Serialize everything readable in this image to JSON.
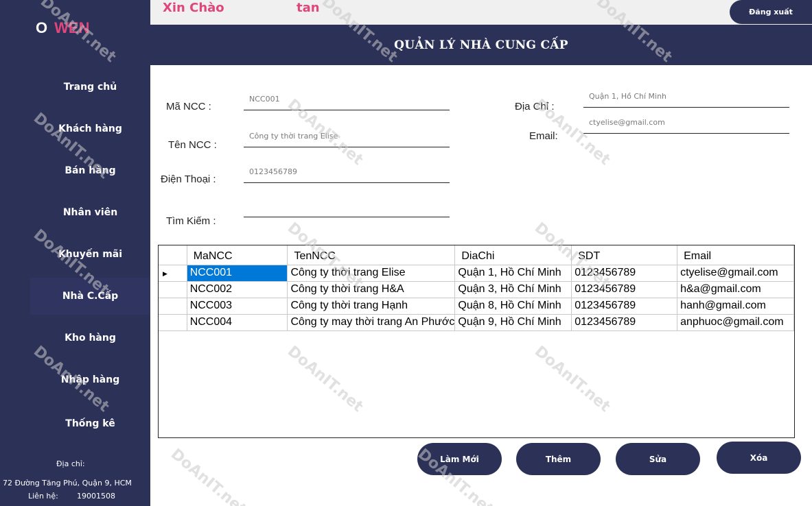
{
  "sidebar": {
    "logo_o": "O",
    "logo_wen": "WEN",
    "items": [
      {
        "label": "Trang chủ"
      },
      {
        "label": "Khách hàng"
      },
      {
        "label": "Bán hàng"
      },
      {
        "label": "Nhân viên"
      },
      {
        "label": "Khuyến mãi"
      },
      {
        "label": "Nhà C.Cấp"
      },
      {
        "label": "Kho hàng"
      },
      {
        "label": "Nhập hàng"
      },
      {
        "label": "Thống kê"
      }
    ],
    "footer": {
      "address_label": "Địa chỉ:",
      "address": "72 Đường Tăng Phú, Quận 9, HCM",
      "contact_label": "Liên hệ:",
      "contact": "19001508"
    }
  },
  "topbar": {
    "greeting": "Xin Chào",
    "username": "tan",
    "logout_label": "Đăng xuất"
  },
  "header": {
    "title": "QUẢN LÝ NHÀ CUNG CẤP"
  },
  "form": {
    "ma_ncc_label": "Mã NCC :",
    "ma_ncc_value": "NCC001",
    "ten_ncc_label": "Tên NCC :",
    "ten_ncc_value": "Công ty thời trang Elise",
    "dien_thoai_label": "Điện Thoại :",
    "dien_thoai_value": "0123456789",
    "tim_kiem_label": "Tìm Kiếm :",
    "tim_kiem_value": "",
    "dia_chi_label": "Địa Chỉ :",
    "dia_chi_value": "Quận 1, Hồ Chí Minh",
    "email_label": "Email:",
    "email_value": "ctyelise@gmail.com"
  },
  "grid": {
    "columns": [
      "MaNCC",
      "TenNCC",
      "DiaChi",
      "SDT",
      "Email"
    ],
    "rows": [
      [
        "NCC001",
        "Công ty thời trang Elise",
        "Quận 1, Hồ Chí Minh",
        "0123456789",
        "ctyelise@gmail.com"
      ],
      [
        "NCC002",
        "Công ty thời trang H&A",
        "Quận 3, Hồ Chí Minh",
        "0123456789",
        "h&a@gmail.com"
      ],
      [
        "NCC003",
        "Công ty thời trang Hạnh",
        "Quận 8, Hồ Chí Minh",
        "0123456789",
        "hanh@gmail.com"
      ],
      [
        "NCC004",
        "Công ty may thời trang An Phước",
        "Quận 9, Hồ Chí Minh",
        "0123456789",
        "anphuoc@gmail.com"
      ]
    ],
    "selected_row": 0,
    "row_marker": "▶"
  },
  "buttons": {
    "refresh": "Làm Mới",
    "add": "Thêm",
    "edit": "Sửa",
    "delete": "Xóa"
  },
  "watermark": {
    "text": "DoAnIT.net"
  }
}
